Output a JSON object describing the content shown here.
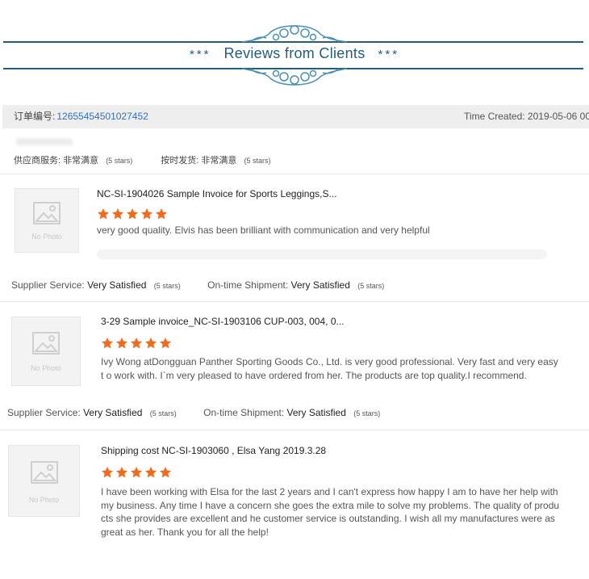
{
  "banner": {
    "title": "Reviews from Clients",
    "left_stars": "***",
    "right_stars": "***"
  },
  "order": {
    "label": "订单编号:",
    "number": "12655454501027452",
    "time_created": "Time Created: 2019-05-06 00"
  },
  "cn_ratings": {
    "supplier_label": "供应商服务:",
    "supplier_value": "非常满意",
    "supplier_stars": "(5 stars)",
    "shipment_label": "按时发货:",
    "shipment_value": "非常满意",
    "shipment_stars": "(5 stars)"
  },
  "no_photo_text": "No Photo",
  "reviews": [
    {
      "title": "NC-SI-1904026 Sample Invoice for Sports Leggings,S...",
      "comment": "very good quality.  Elvis has been brilliant with communication and very helpful",
      "supplier_label": "Supplier Service:",
      "supplier_value": "Very Satisfied",
      "supplier_stars": "(5 stars)",
      "shipment_label": "On-time Shipment:",
      "shipment_value": "Very Satisfied",
      "shipment_stars": "(5 stars)"
    },
    {
      "title": "3-29 Sample invoice_NC-SI-1903106 CUP-003, 004, 0...",
      "comment": "Ivy Wong atDongguan Panther Sporting Goods Co., Ltd. is very good professional. Very fast and very easy t o work with. I`m very pleased to have ordered from her. The products are top quality.I recommend.",
      "supplier_label": "Supplier Service:",
      "supplier_value": "Very Satisfied",
      "supplier_stars": "(5 stars)",
      "shipment_label": "On-time Shipment:",
      "shipment_value": "Very Satisfied",
      "shipment_stars": "(5 stars)"
    },
    {
      "title": "Shipping cost NC-SI-1903060 , Elsa Yang 2019.3.28",
      "comment": "I have been working with Elsa for the last 2 years and I can't express how happy I am to have her help with my business. Any time I have a concern she goes the extra mile to solve my problems. The quality of produ cts she provides are excellent and he customer service is outstanding. I wish all my manufactures were as great as her. Thank you for all the help!"
    }
  ],
  "colors": {
    "star": "#f26a1b",
    "banner": "#235d78",
    "link": "#2d73b8"
  }
}
